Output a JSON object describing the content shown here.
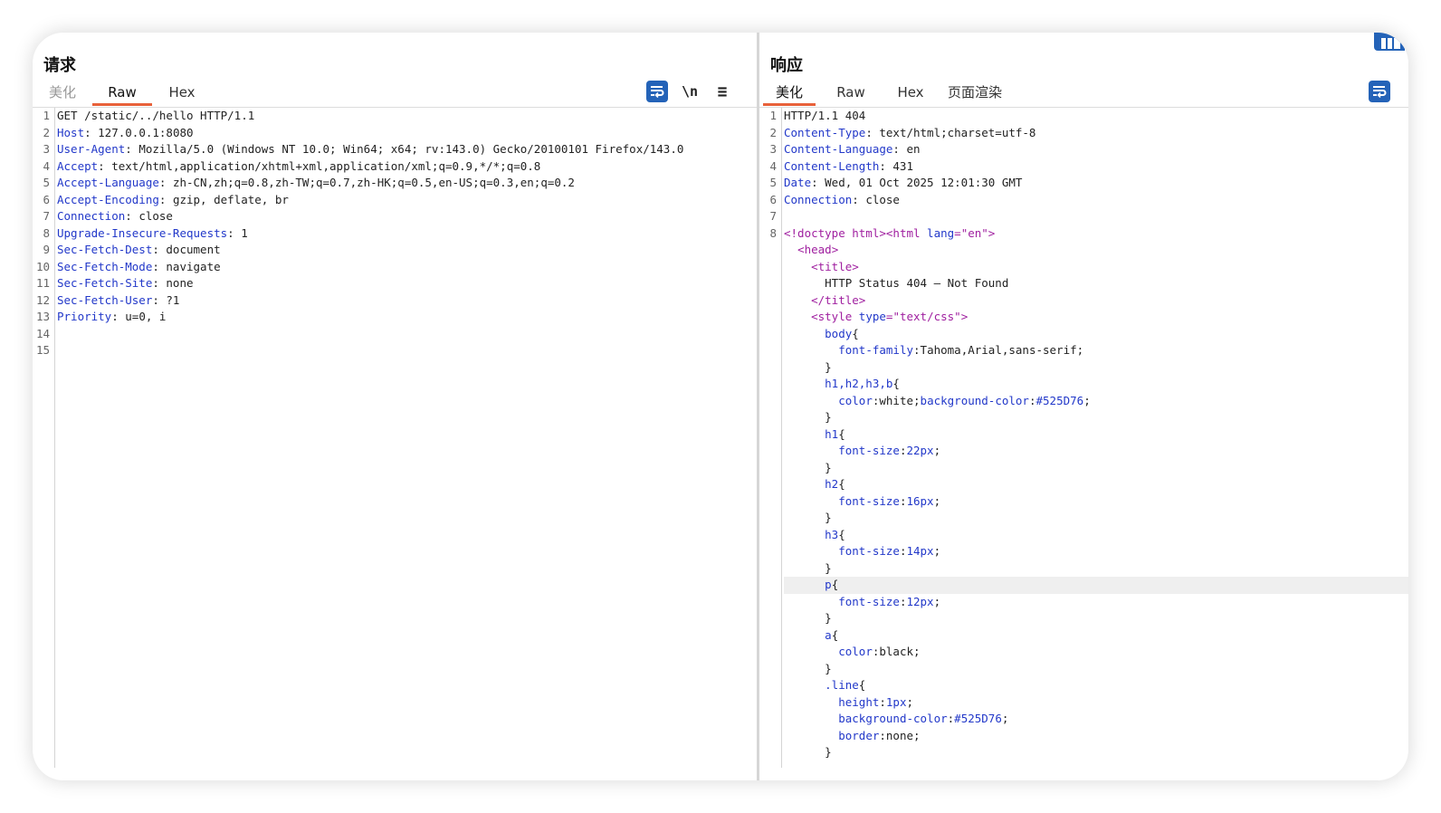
{
  "request": {
    "title": "请求",
    "tabs": [
      "美化",
      "Raw",
      "Hex"
    ],
    "active_tab": 1,
    "toolbar": {
      "newline_label": "\\n",
      "menu_label": "≡"
    },
    "highlight_line": 15,
    "lines": [
      [
        {
          "t": "GET /static/../hello HTTP/1.1"
        }
      ],
      [
        {
          "t": "Host",
          "c": "k"
        },
        {
          "t": ": 127.0.0.1:8080"
        }
      ],
      [
        {
          "t": "User-Agent",
          "c": "k"
        },
        {
          "t": ": Mozilla/5.0 (Windows NT 10.0; Win64; x64; rv:143.0) Gecko/20100101 Firefox/143.0"
        }
      ],
      [
        {
          "t": "Accept",
          "c": "k"
        },
        {
          "t": ": text/html,application/xhtml+xml,application/xml;q=0.9,*/*;q=0.8"
        }
      ],
      [
        {
          "t": "Accept-Language",
          "c": "k"
        },
        {
          "t": ": zh-CN,zh;q=0.8,zh-TW;q=0.7,zh-HK;q=0.5,en-US;q=0.3,en;q=0.2"
        }
      ],
      [
        {
          "t": "Accept-Encoding",
          "c": "k"
        },
        {
          "t": ": gzip, deflate, br"
        }
      ],
      [
        {
          "t": "Connection",
          "c": "k"
        },
        {
          "t": ": close"
        }
      ],
      [
        {
          "t": "Upgrade-Insecure-Requests",
          "c": "k"
        },
        {
          "t": ": 1"
        }
      ],
      [
        {
          "t": "Sec-Fetch-Dest",
          "c": "k"
        },
        {
          "t": ": document"
        }
      ],
      [
        {
          "t": "Sec-Fetch-Mode",
          "c": "k"
        },
        {
          "t": ": navigate"
        }
      ],
      [
        {
          "t": "Sec-Fetch-Site",
          "c": "k"
        },
        {
          "t": ": none"
        }
      ],
      [
        {
          "t": "Sec-Fetch-User",
          "c": "k"
        },
        {
          "t": ": ?1"
        }
      ],
      [
        {
          "t": "Priority",
          "c": "k"
        },
        {
          "t": ": u=0, i"
        }
      ],
      [],
      []
    ]
  },
  "response": {
    "title": "响应",
    "tabs": [
      "美化",
      "Raw",
      "Hex",
      "页面渲染"
    ],
    "active_tab": 0,
    "highlight_line": 29,
    "lines": [
      {
        "n": "1",
        "s": [
          {
            "t": "HTTP/1.1 404"
          }
        ]
      },
      {
        "n": "2",
        "s": [
          {
            "t": "Content-Type",
            "c": "k"
          },
          {
            "t": ": text/html;charset=utf-8"
          }
        ]
      },
      {
        "n": "3",
        "s": [
          {
            "t": "Content-Language",
            "c": "k"
          },
          {
            "t": ": en"
          }
        ]
      },
      {
        "n": "4",
        "s": [
          {
            "t": "Content-Length",
            "c": "k"
          },
          {
            "t": ": 431"
          }
        ]
      },
      {
        "n": "5",
        "s": [
          {
            "t": "Date",
            "c": "k"
          },
          {
            "t": ": Wed, 01 Oct 2025 12:01:30 GMT"
          }
        ]
      },
      {
        "n": "6",
        "s": [
          {
            "t": "Connection",
            "c": "k"
          },
          {
            "t": ": close"
          }
        ]
      },
      {
        "n": "7",
        "s": []
      },
      {
        "n": "8",
        "s": [
          {
            "t": "<!doctype html>",
            "c": "t"
          },
          {
            "t": "<html ",
            "c": "t"
          },
          {
            "t": "lang",
            "c": "a"
          },
          {
            "t": "=",
            "c": "t"
          },
          {
            "t": "\"en\"",
            "c": "s"
          },
          {
            "t": ">",
            "c": "t"
          }
        ]
      },
      {
        "n": "",
        "s": [
          {
            "t": "  "
          },
          {
            "t": "<head>",
            "c": "t"
          }
        ]
      },
      {
        "n": "",
        "s": [
          {
            "t": "    "
          },
          {
            "t": "<title>",
            "c": "t"
          }
        ]
      },
      {
        "n": "",
        "s": [
          {
            "t": "      HTTP Status 404 – Not Found"
          }
        ]
      },
      {
        "n": "",
        "s": [
          {
            "t": "    "
          },
          {
            "t": "</title>",
            "c": "t"
          }
        ]
      },
      {
        "n": "",
        "s": [
          {
            "t": "    "
          },
          {
            "t": "<style ",
            "c": "t"
          },
          {
            "t": "type",
            "c": "a"
          },
          {
            "t": "=",
            "c": "t"
          },
          {
            "t": "\"text/css\"",
            "c": "s"
          },
          {
            "t": ">",
            "c": "t"
          }
        ]
      },
      {
        "n": "",
        "s": [
          {
            "t": "      "
          },
          {
            "t": "body",
            "c": "k"
          },
          {
            "t": "{"
          }
        ]
      },
      {
        "n": "",
        "s": [
          {
            "t": "        "
          },
          {
            "t": "font-family",
            "c": "k"
          },
          {
            "t": ":Tahoma,Arial,sans-serif;"
          }
        ]
      },
      {
        "n": "",
        "s": [
          {
            "t": "      }"
          }
        ]
      },
      {
        "n": "",
        "s": [
          {
            "t": "      "
          },
          {
            "t": "h1,h2,h3,b",
            "c": "k"
          },
          {
            "t": "{"
          }
        ]
      },
      {
        "n": "",
        "s": [
          {
            "t": "        "
          },
          {
            "t": "color",
            "c": "k"
          },
          {
            "t": ":white;"
          },
          {
            "t": "background-color",
            "c": "k"
          },
          {
            "t": ":"
          },
          {
            "t": "#525D76",
            "c": "v"
          },
          {
            "t": ";"
          }
        ]
      },
      {
        "n": "",
        "s": [
          {
            "t": "      }"
          }
        ]
      },
      {
        "n": "",
        "s": [
          {
            "t": "      "
          },
          {
            "t": "h1",
            "c": "k"
          },
          {
            "t": "{"
          }
        ]
      },
      {
        "n": "",
        "s": [
          {
            "t": "        "
          },
          {
            "t": "font-size",
            "c": "k"
          },
          {
            "t": ":"
          },
          {
            "t": "22px",
            "c": "v"
          },
          {
            "t": ";"
          }
        ]
      },
      {
        "n": "",
        "s": [
          {
            "t": "      }"
          }
        ]
      },
      {
        "n": "",
        "s": [
          {
            "t": "      "
          },
          {
            "t": "h2",
            "c": "k"
          },
          {
            "t": "{"
          }
        ]
      },
      {
        "n": "",
        "s": [
          {
            "t": "        "
          },
          {
            "t": "font-size",
            "c": "k"
          },
          {
            "t": ":"
          },
          {
            "t": "16px",
            "c": "v"
          },
          {
            "t": ";"
          }
        ]
      },
      {
        "n": "",
        "s": [
          {
            "t": "      }"
          }
        ]
      },
      {
        "n": "",
        "s": [
          {
            "t": "      "
          },
          {
            "t": "h3",
            "c": "k"
          },
          {
            "t": "{"
          }
        ]
      },
      {
        "n": "",
        "s": [
          {
            "t": "        "
          },
          {
            "t": "font-size",
            "c": "k"
          },
          {
            "t": ":"
          },
          {
            "t": "14px",
            "c": "v"
          },
          {
            "t": ";"
          }
        ]
      },
      {
        "n": "",
        "s": [
          {
            "t": "      }"
          }
        ]
      },
      {
        "n": "",
        "s": [
          {
            "t": "      "
          },
          {
            "t": "p",
            "c": "k"
          },
          {
            "t": "{"
          }
        ]
      },
      {
        "n": "",
        "s": [
          {
            "t": "        "
          },
          {
            "t": "font-size",
            "c": "k"
          },
          {
            "t": ":"
          },
          {
            "t": "12px",
            "c": "v"
          },
          {
            "t": ";"
          }
        ]
      },
      {
        "n": "",
        "s": [
          {
            "t": "      }"
          }
        ]
      },
      {
        "n": "",
        "s": [
          {
            "t": "      "
          },
          {
            "t": "a",
            "c": "k"
          },
          {
            "t": "{"
          }
        ]
      },
      {
        "n": "",
        "s": [
          {
            "t": "        "
          },
          {
            "t": "color",
            "c": "k"
          },
          {
            "t": ":black;"
          }
        ]
      },
      {
        "n": "",
        "s": [
          {
            "t": "      }"
          }
        ]
      },
      {
        "n": "",
        "s": [
          {
            "t": "      "
          },
          {
            "t": ".line",
            "c": "k"
          },
          {
            "t": "{"
          }
        ]
      },
      {
        "n": "",
        "s": [
          {
            "t": "        "
          },
          {
            "t": "height",
            "c": "k"
          },
          {
            "t": ":"
          },
          {
            "t": "1px",
            "c": "v"
          },
          {
            "t": ";"
          }
        ]
      },
      {
        "n": "",
        "s": [
          {
            "t": "        "
          },
          {
            "t": "background-color",
            "c": "k"
          },
          {
            "t": ":"
          },
          {
            "t": "#525D76",
            "c": "v"
          },
          {
            "t": ";"
          }
        ]
      },
      {
        "n": "",
        "s": [
          {
            "t": "        "
          },
          {
            "t": "border",
            "c": "k"
          },
          {
            "t": ":none;"
          }
        ]
      },
      {
        "n": "",
        "s": [
          {
            "t": "      }"
          }
        ]
      }
    ]
  },
  "colors": {
    "accent_tab": "#e8613a",
    "wrap_button": "#2463b8",
    "header_key": "#2238c9",
    "tag": "#a020a0"
  },
  "icons": {
    "wrap": "wrap-lines-icon",
    "newline": "newline-toggle-icon",
    "menu": "hamburger-menu-icon",
    "corner": "layout-toggle-icon"
  }
}
